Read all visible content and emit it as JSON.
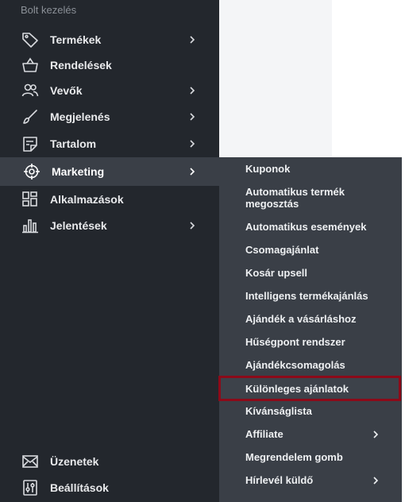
{
  "sidebar": {
    "section_title": "Bolt kezelés",
    "items": [
      {
        "label": "Termékek",
        "icon": "tag-icon"
      },
      {
        "label": "Rendelések",
        "icon": "basket-icon"
      },
      {
        "label": "Vevők",
        "icon": "users-icon"
      },
      {
        "label": "Megjelenés",
        "icon": "brush-icon"
      },
      {
        "label": "Tartalom",
        "icon": "document-icon"
      },
      {
        "label": "Marketing",
        "icon": "crosshair-icon"
      },
      {
        "label": "Alkalmazások",
        "icon": "apps-icon"
      },
      {
        "label": "Jelentések",
        "icon": "bar-chart-icon"
      }
    ],
    "bottom_items": [
      {
        "label": "Üzenetek",
        "icon": "mail-icon"
      },
      {
        "label": "Beállítások",
        "icon": "settings-icon"
      }
    ]
  },
  "submenu": {
    "items": [
      {
        "label": "Kuponok"
      },
      {
        "label": "Automatikus termék megosztás"
      },
      {
        "label": "Automatikus események"
      },
      {
        "label": "Csomagajánlat"
      },
      {
        "label": "Kosár upsell"
      },
      {
        "label": "Intelligens termékajánlás"
      },
      {
        "label": "Ajándék a vásárláshoz"
      },
      {
        "label": "Hűségpont rendszer"
      },
      {
        "label": "Ajándékcsomagolás"
      },
      {
        "label": "Különleges ajánlatok"
      },
      {
        "label": "Kívánságlista"
      },
      {
        "label": "Affiliate"
      },
      {
        "label": "Megrendelem gomb"
      },
      {
        "label": "Hírlevél küldő"
      }
    ]
  },
  "colors": {
    "sidebar_bg": "#23272d",
    "submenu_bg": "#3a3f47",
    "highlight_border": "#8c0a19"
  }
}
